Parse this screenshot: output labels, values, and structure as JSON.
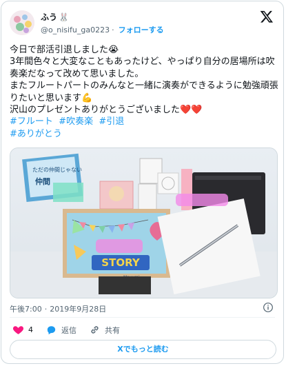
{
  "author": {
    "name": "ふう",
    "name_emoji": "🐰",
    "handle": "@o_nisifu_ga0223",
    "separator": "·",
    "follow_label": "フォローする"
  },
  "tweet": {
    "line1": "今日で部活引退しました😭",
    "line2": "3年間色々と大変なこともあったけど、やっぱり自分の居場所は吹奏楽だなって改めて思いました。",
    "line3": "またフルートパートのみんなと一緒に演奏ができるように勉強頑張りたいと思います💪",
    "line4": "沢山のプレゼントありがとうございました❤️❤️",
    "hashtags": [
      "#フルート",
      "#吹奏楽",
      "#引退",
      "#ありがとう"
    ]
  },
  "photo": {
    "card_text_1": "ただの仲間じゃない",
    "card_text_2": "仲間",
    "story": "STORY",
    "signature": "Mayumi"
  },
  "meta": {
    "time": "午後7:00",
    "separator": "·",
    "date": "2019年9月28日"
  },
  "actions": {
    "like_count": "4",
    "reply_label": "返信",
    "share_label": "共有"
  },
  "readmore_label": "Xでもっと読む",
  "colors": {
    "accent": "#1d9bf0",
    "like": "#f91880",
    "text": "#0f1419",
    "muted": "#536471"
  }
}
